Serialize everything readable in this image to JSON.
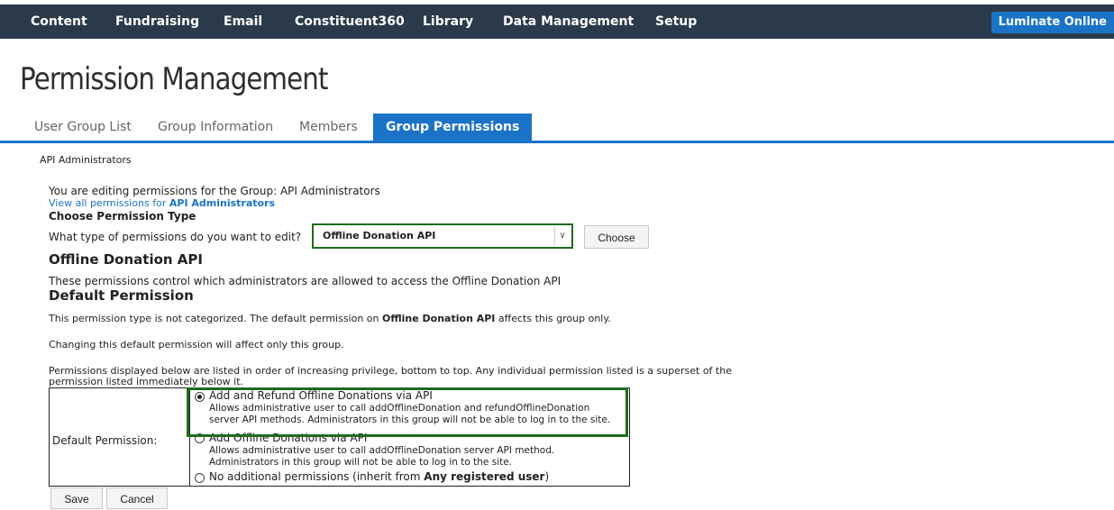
{
  "nav": {
    "items": [
      "Content",
      "Fundraising",
      "Email",
      "Constituent360",
      "Library",
      "Data Management",
      "Setup"
    ],
    "brand": "Luminate Online"
  },
  "page_title": "Permission Management",
  "tabs": [
    "User Group List",
    "Group Information",
    "Members",
    "Group Permissions"
  ],
  "group_label": "API Administrators",
  "editing_text": "You are editing permissions for the Group: API Administrators",
  "view_all_prefix": "View all permissions for ",
  "view_all_group": "API Administrators",
  "choose_type_heading": "Choose Permission Type",
  "question": "What type of permissions do you want to edit?",
  "select_value": "Offline Donation API",
  "choose_button": "Choose",
  "section_title": "Offline Donation API",
  "section_desc": "These permissions control which administrators are allowed to access the Offline Donation API",
  "default_heading": "Default Permission",
  "uncategorized_prefix": "This permission type is not categorized. The default permission on ",
  "uncategorized_bold": "Offline Donation API",
  "uncategorized_suffix": " affects this group only.",
  "changing_text": "Changing this default permission will affect only this group.",
  "order_text_1": "Permissions displayed below are listed in order of increasing privilege, bottom to top. Any individual permission listed is a superset of the",
  "order_text_2": "permission listed immediately below it.",
  "default_permission_label": "Default Permission:",
  "options": [
    {
      "title": "Add and Refund Offline Donations via API",
      "desc_1": "Allows administrative user to call addOfflineDonation and refundOfflineDonation",
      "desc_2": "server API methods. Administrators in this group will not be able to log in to the site.",
      "selected": true
    },
    {
      "title": "Add Offline Donations via API",
      "desc_1": "Allows administrative user to call addOfflineDonation server API method.",
      "desc_2": "Administrators in this group will not be able to log in to the site.",
      "selected": false
    },
    {
      "title_prefix": "No additional permissions (inherit from ",
      "title_bold": "Any registered user",
      "title_suffix": ")",
      "selected": false
    }
  ],
  "save_button": "Save",
  "cancel_button": "Cancel",
  "colors": {
    "nav_bg": "#2b3a4a",
    "accent": "#1a73c7",
    "highlight": "#1e6b1e"
  }
}
